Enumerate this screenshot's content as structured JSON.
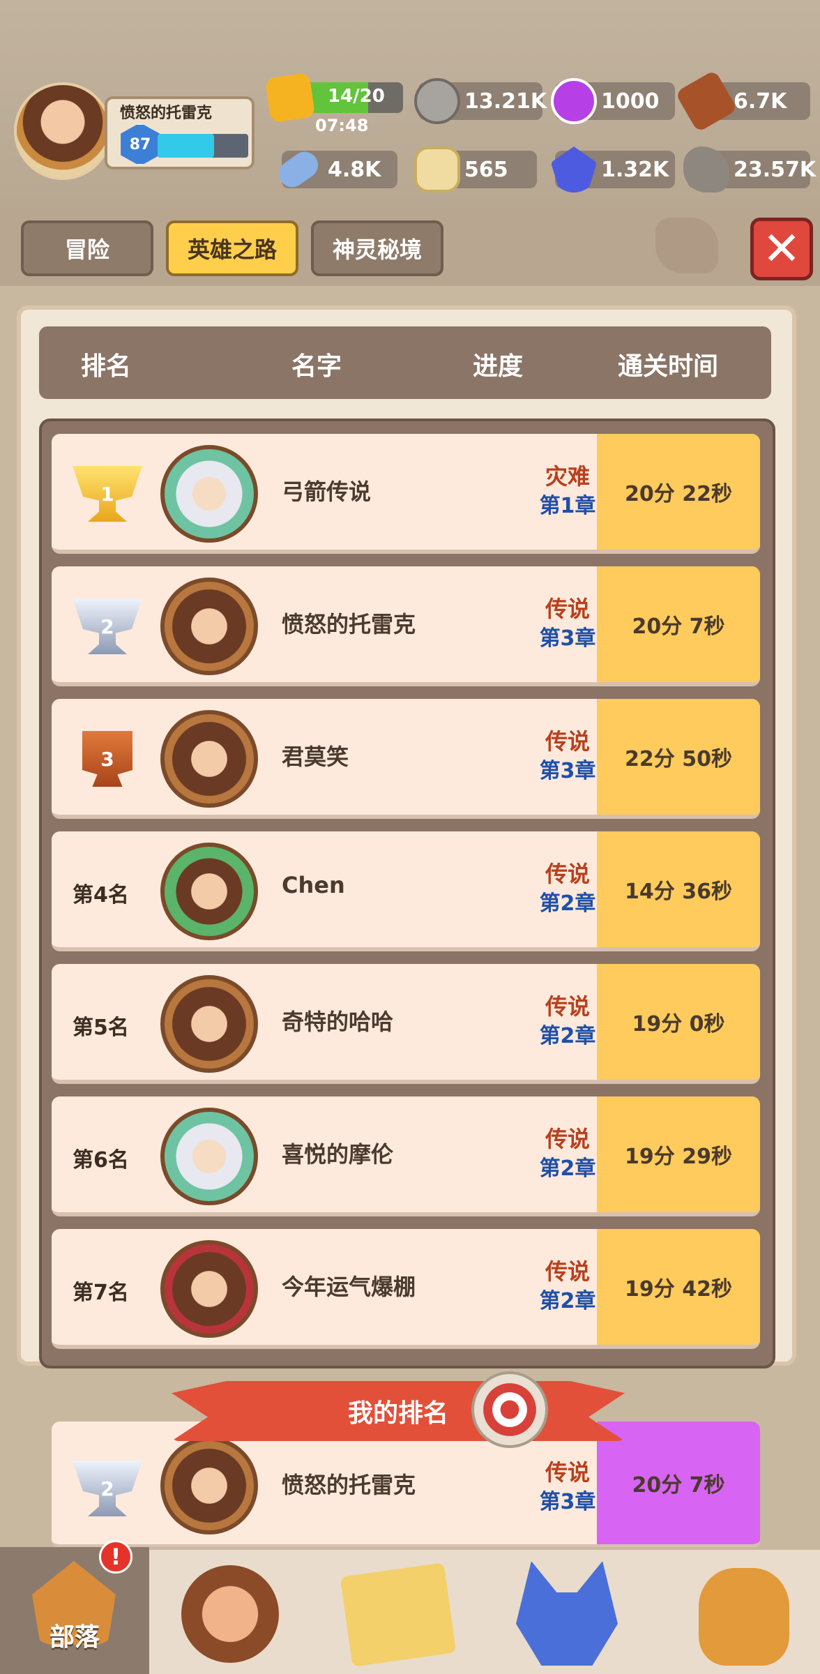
{
  "player": {
    "name": "愤怒的托雷克",
    "level": "87",
    "xp_fraction": 0.62
  },
  "resources": {
    "energy": {
      "value": "14/20",
      "timer": "07:48",
      "fraction": 0.7,
      "icon": "energy-icon"
    },
    "nuts": {
      "value": "13.21K",
      "icon": "nut-icon"
    },
    "gems_purple": {
      "value": "1000",
      "icon": "purple-orb-icon"
    },
    "wood": {
      "value": "6.7K",
      "icon": "wood-icon"
    },
    "bone": {
      "value": "4.8K",
      "icon": "bone-icon"
    },
    "coin": {
      "value": "565",
      "icon": "coin-icon"
    },
    "crystal": {
      "value": "1.32K",
      "icon": "crystal-icon"
    },
    "stone": {
      "value": "23.57K",
      "icon": "stone-icon"
    }
  },
  "tabs": [
    {
      "label": "冒险",
      "active": false
    },
    {
      "label": "英雄之路",
      "active": true
    },
    {
      "label": "神灵秘境",
      "active": false
    }
  ],
  "table": {
    "headers": {
      "rank": "排名",
      "name": "名字",
      "progress": "进度",
      "time": "通关时间"
    },
    "rows": [
      {
        "rank": "1",
        "trophy": "gold",
        "name": "弓箭传说",
        "difficulty": "灾难",
        "chapter": "第1章",
        "time": "20分 22秒",
        "avatar": "white-hair"
      },
      {
        "rank": "2",
        "trophy": "silver",
        "name": "愤怒的托雷克",
        "difficulty": "传说",
        "chapter": "第3章",
        "time": "20分 7秒",
        "avatar": "brown-hair"
      },
      {
        "rank": "3",
        "trophy": "bronze",
        "name": "君莫笑",
        "difficulty": "传说",
        "chapter": "第3章",
        "time": "22分 50秒",
        "avatar": "brown-hair"
      },
      {
        "rank": "第4名",
        "trophy": "",
        "name": "Chen",
        "difficulty": "传说",
        "chapter": "第2章",
        "time": "14分 36秒",
        "avatar": "green-frame"
      },
      {
        "rank": "第5名",
        "trophy": "",
        "name": "奇特的哈哈",
        "difficulty": "传说",
        "chapter": "第2章",
        "time": "19分 0秒",
        "avatar": "brown-hair"
      },
      {
        "rank": "第6名",
        "trophy": "",
        "name": "喜悦的摩伦",
        "difficulty": "传说",
        "chapter": "第2章",
        "time": "19分 29秒",
        "avatar": "white-hair"
      },
      {
        "rank": "第7名",
        "trophy": "",
        "name": "今年运气爆棚",
        "difficulty": "传说",
        "chapter": "第2章",
        "time": "19分 42秒",
        "avatar": "red-frame"
      }
    ]
  },
  "my_rank": {
    "label": "我的排名",
    "rank": "2",
    "name": "愤怒的托雷克",
    "difficulty": "传说",
    "chapter": "第3章",
    "time": "20分 7秒"
  },
  "bottom_nav": [
    {
      "label": "部落",
      "icon": "tribe-icon",
      "active": true,
      "alert": "!"
    },
    {
      "label": "",
      "icon": "hero-icon",
      "active": false
    },
    {
      "label": "",
      "icon": "map-icon",
      "active": false
    },
    {
      "label": "",
      "icon": "pet-icon",
      "active": false
    },
    {
      "label": "",
      "icon": "bag-icon",
      "active": false
    }
  ],
  "colors": {
    "time_cell": "#ffcb5c",
    "my_time_cell": "#d764f2",
    "active_tab": "#ffcf4b",
    "close_button": "#e0473d"
  }
}
